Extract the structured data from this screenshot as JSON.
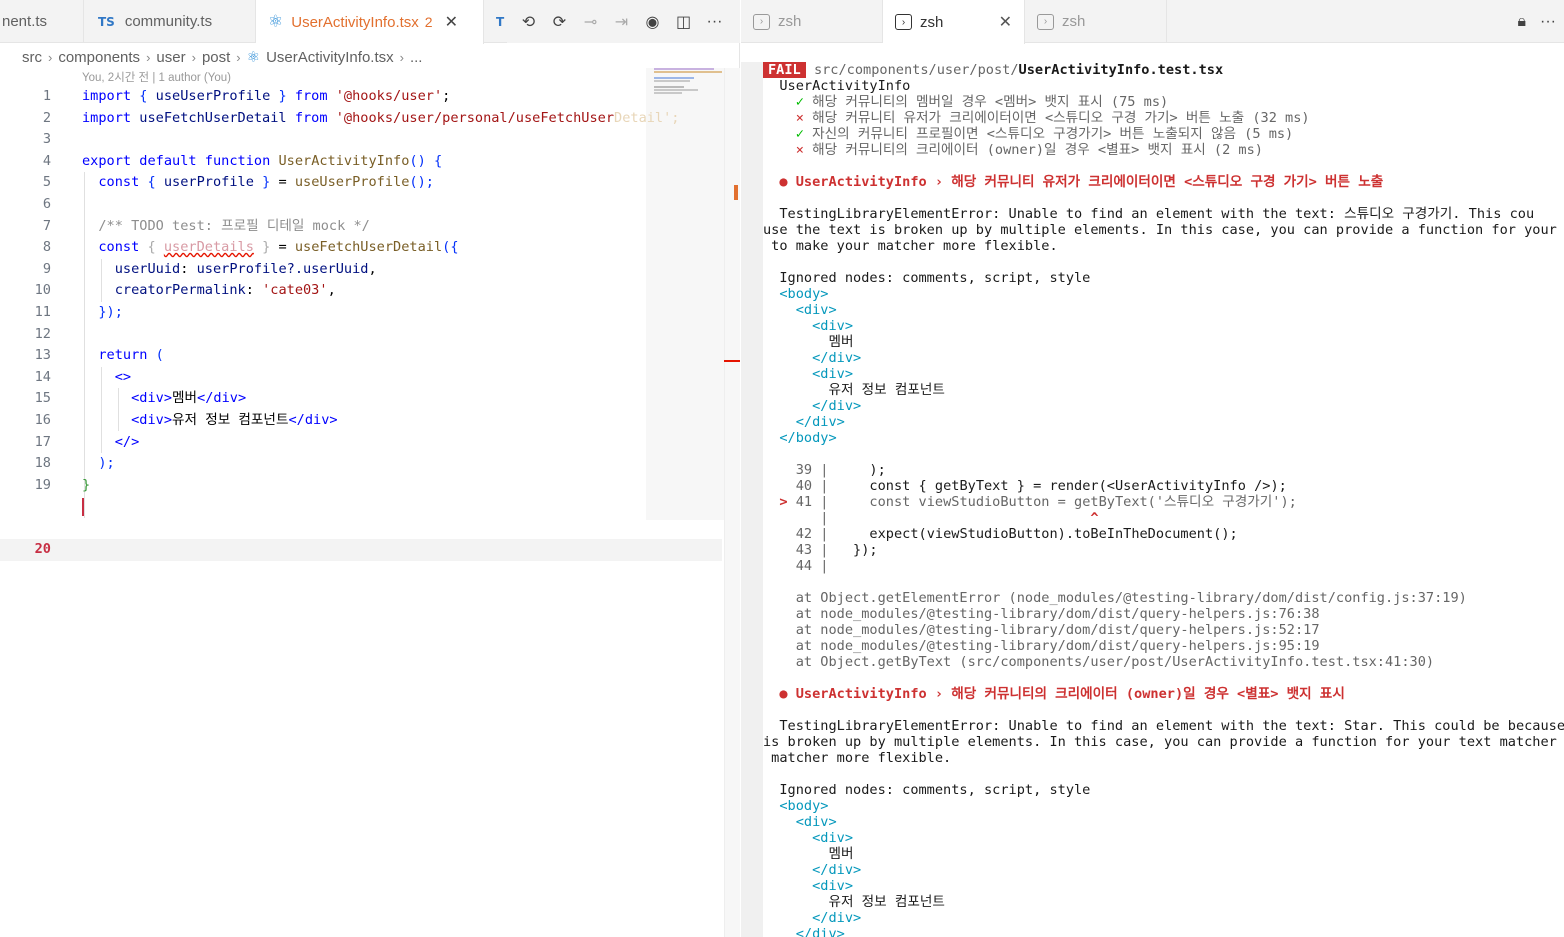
{
  "editor": {
    "tabs": [
      {
        "label": "nent.ts",
        "icon": "ts-badge"
      },
      {
        "label": "community.ts",
        "icon": "ts-badge",
        "badge": "TS"
      },
      {
        "label": "UserActivityInfo.tsx",
        "icon": "react-icon",
        "problems": "2",
        "active": true
      },
      {
        "label": "T",
        "icon": "ts-badge"
      }
    ],
    "tab_actions": [
      "history-icon",
      "go-back-icon",
      "commit-icon",
      "go-forward-icon",
      "git-lens-icon",
      "split-editor-icon",
      "more-icon"
    ],
    "breadcrumb": [
      "src",
      "components",
      "user",
      "post",
      "UserActivityInfo.tsx",
      "..."
    ],
    "blame": "You, 2시간 전 | 1 author (You)",
    "line_numbers": [
      "1",
      "2",
      "3",
      "4",
      "5",
      "6",
      "7",
      "8",
      "9",
      "10",
      "11",
      "12",
      "13",
      "14",
      "15",
      "16",
      "17",
      "18",
      "19",
      "20"
    ],
    "current_line": "20",
    "code": {
      "l1": {
        "k1": "import",
        "b1": "{",
        "v1": "useUserProfile",
        "b2": "}",
        "k2": "from",
        "s": "'@hooks/user'",
        "p": ";"
      },
      "l2": {
        "k1": "import",
        "v1": "useFetchUserDetail",
        "k2": "from",
        "s": "'@hooks/user/personal/useFetchUser",
        "s_fade": "Detail';"
      },
      "l4": {
        "k1": "export",
        "k2": "default",
        "k3": "function",
        "f": "UserActivityInfo",
        "p": "()",
        "b": "{"
      },
      "l5": {
        "k": "const",
        "b1": "{",
        "v": "userProfile",
        "b2": "}",
        "p": "=",
        "f": "useUserProfile",
        "p2": "();"
      },
      "l7": {
        "c": "/** TODO test: 프로필 디테일 mock */"
      },
      "l8": {
        "k": "const",
        "b1": "{",
        "v": "userDetails",
        "b2": "}",
        "p": "=",
        "f": "useFetchUserDetail",
        "p2": "({"
      },
      "l9": {
        "v1": "userUuid",
        "p": ":",
        "v2": "userProfile?.userUuid",
        "p2": ","
      },
      "l10": {
        "v": "creatorPermalink",
        "p": ":",
        "s": "'cate03'",
        "p2": ","
      },
      "l11": {
        "p": "});"
      },
      "l13": {
        "k": "return",
        "b": "("
      },
      "l14": {
        "tag": "<>"
      },
      "l15": {
        "tag1": "<div>",
        "txt": "멤버",
        "tag2": "</div>"
      },
      "l16": {
        "tag1": "<div>",
        "txt": "유저 정보 컴포넌트",
        "tag2": "</div>"
      },
      "l17": {
        "tag": "</>"
      },
      "l18": {
        "p": ");"
      },
      "l19": {
        "b": "}"
      }
    }
  },
  "terminal": {
    "tabs": [
      {
        "label": "zsh",
        "icon": "terminal-icon"
      },
      {
        "label": "zsh",
        "icon": "terminal-icon",
        "active": true
      },
      {
        "label": "zsh",
        "icon": "terminal-icon"
      }
    ],
    "actions": [
      "lock-icon",
      "more-icon"
    ],
    "fail_badge": "FAIL",
    "test_path_dir": "src/components/user/post/",
    "test_path_file": "UserActivityInfo.test.tsx",
    "suite": "UserActivityInfo",
    "results": [
      {
        "mark": "✓",
        "status": "pass",
        "text": "해당 커뮤니티의 멤버일 경우 <멤버> 뱃지 표시 (75 ms)"
      },
      {
        "mark": "×",
        "status": "fail",
        "text": "해당 커뮤니티 유저가 크리에이터이면 <스튜디오 구경 가기> 버튼 노출 (32 ms)"
      },
      {
        "mark": "✓",
        "status": "pass",
        "text": "자신의 커뮤니티 프로필이면 <스튜디오 구경가기> 버튼 노출되지 않음 (5 ms)"
      },
      {
        "mark": "×",
        "status": "fail",
        "text": "해당 커뮤니티의 크리에이터 (owner)일 경우 <별표> 뱃지 표시 (2 ms)"
      }
    ],
    "failure1": {
      "bullet": "●",
      "title": "UserActivityInfo › 해당 커뮤니티 유저가 크리에이터이면 <스튜디오 구경 가기> 버튼 노출",
      "error_lines": [
        "  TestingLibraryElementError: Unable to find an element with the text: 스튜디오 구경가기. This cou",
        "use the text is broken up by multiple elements. In this case, you can provide a function for your te",
        " to make your matcher more flexible."
      ],
      "ignored": "  Ignored nodes: comments, script, style",
      "dom": [
        "  <body>",
        "    <div>",
        "      <div>",
        "        멤버",
        "      </div>",
        "      <div>",
        "        유저 정보 컴포넌트",
        "      </div>",
        "    </div>",
        "  </body>"
      ],
      "snippet": [
        {
          "prefix": "    ",
          "num": "39",
          "code": "     );"
        },
        {
          "prefix": "    ",
          "num": "40",
          "code": "     const { getByText } = render(<UserActivityInfo />);"
        },
        {
          "prefix": "  > ",
          "num": "41",
          "code": "     const viewStudioButton = getByText('스튜디오 구경가기');"
        },
        {
          "prefix": "    ",
          "num": "",
          "code": "                                ^"
        },
        {
          "prefix": "    ",
          "num": "42",
          "code": "     expect(viewStudioButton).toBeInTheDocument();"
        },
        {
          "prefix": "    ",
          "num": "43",
          "code": "   });"
        },
        {
          "prefix": "    ",
          "num": "44",
          "code": ""
        }
      ],
      "stack": [
        "    at Object.getElementError (node_modules/@testing-library/dom/dist/config.js:37:19)",
        "    at node_modules/@testing-library/dom/dist/query-helpers.js:76:38",
        "    at node_modules/@testing-library/dom/dist/query-helpers.js:52:17",
        "    at node_modules/@testing-library/dom/dist/query-helpers.js:95:19",
        "    at Object.getByText (src/components/user/post/UserActivityInfo.test.tsx:41:30)"
      ]
    },
    "failure2": {
      "bullet": "●",
      "title": "UserActivityInfo › 해당 커뮤니티의 크리에이터 (owner)일 경우 <별표> 뱃지 표시",
      "error_lines": [
        "  TestingLibraryElementError: Unable to find an element with the text: Star. This could be because",
        "is broken up by multiple elements. In this case, you can provide a function for your text matcher to",
        " matcher more flexible."
      ],
      "ignored": "  Ignored nodes: comments, script, style",
      "dom": [
        "  <body>",
        "    <div>",
        "      <div>",
        "        멤버",
        "      </div>",
        "      <div>",
        "        유저 정보 컴포넌트",
        "      </div>",
        "    </div>"
      ]
    }
  }
}
